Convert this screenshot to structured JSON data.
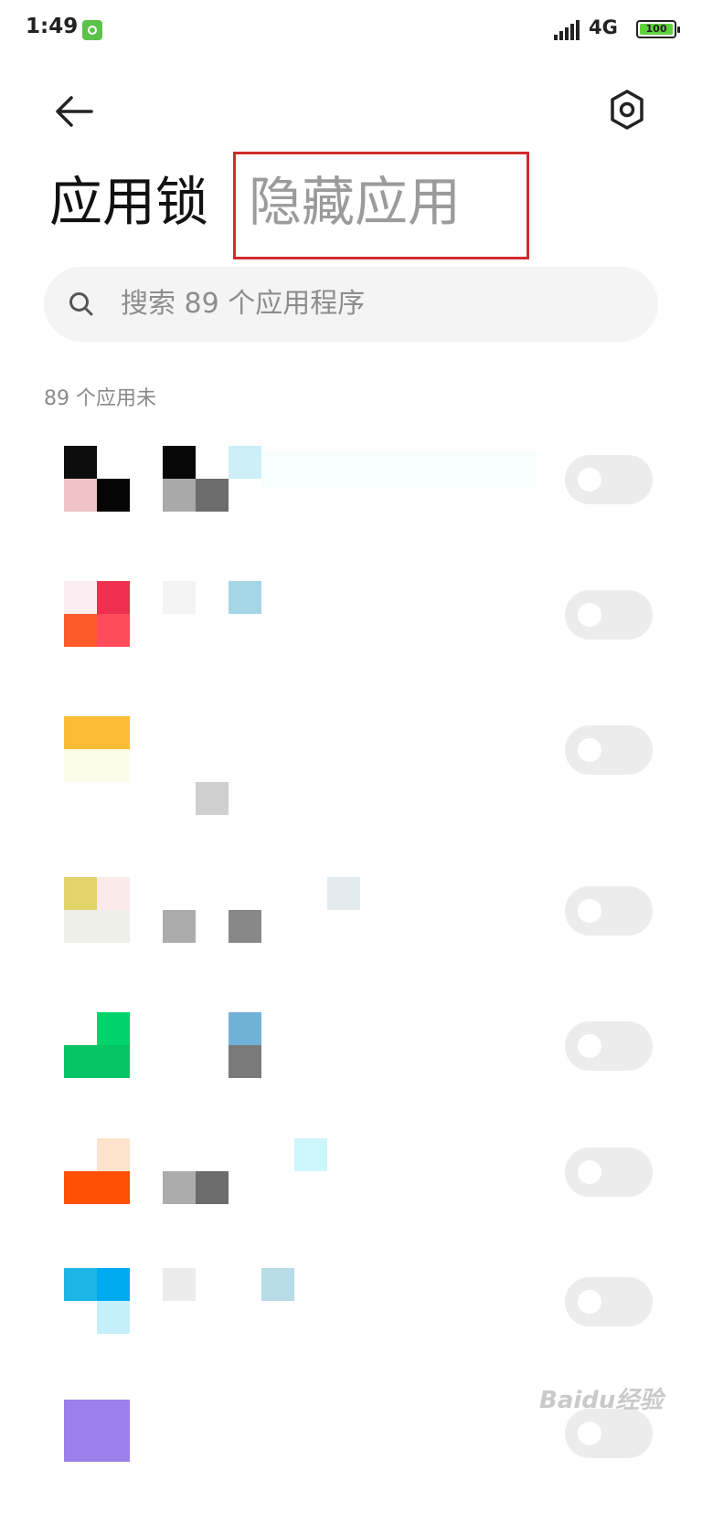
{
  "status_bar": {
    "time": "1:49",
    "network": "4G",
    "battery": "100",
    "notif_icon": "app-notification-icon",
    "signal_icon": "signal-bars-icon"
  },
  "header": {
    "back_icon": "arrow-left-icon",
    "settings_icon": "hexagon-settings-icon"
  },
  "tabs": [
    {
      "label": "应用锁",
      "active": true
    },
    {
      "label": "隐藏应用",
      "active": false
    }
  ],
  "search": {
    "placeholder": "搜索 89 个应用程序",
    "icon": "search-icon"
  },
  "list": {
    "count_label": "89 个应用未",
    "apps": [
      {
        "toggle_on": false
      },
      {
        "toggle_on": false
      },
      {
        "toggle_on": false
      },
      {
        "toggle_on": false
      },
      {
        "toggle_on": false
      },
      {
        "toggle_on": false
      },
      {
        "toggle_on": false
      },
      {
        "toggle_on": false
      }
    ]
  },
  "watermark": "Baidu经验",
  "colors": {
    "highlight_border": "#d12b2b",
    "inactive_tab": "#9b9b9b",
    "toggle_off": "#ececec"
  }
}
